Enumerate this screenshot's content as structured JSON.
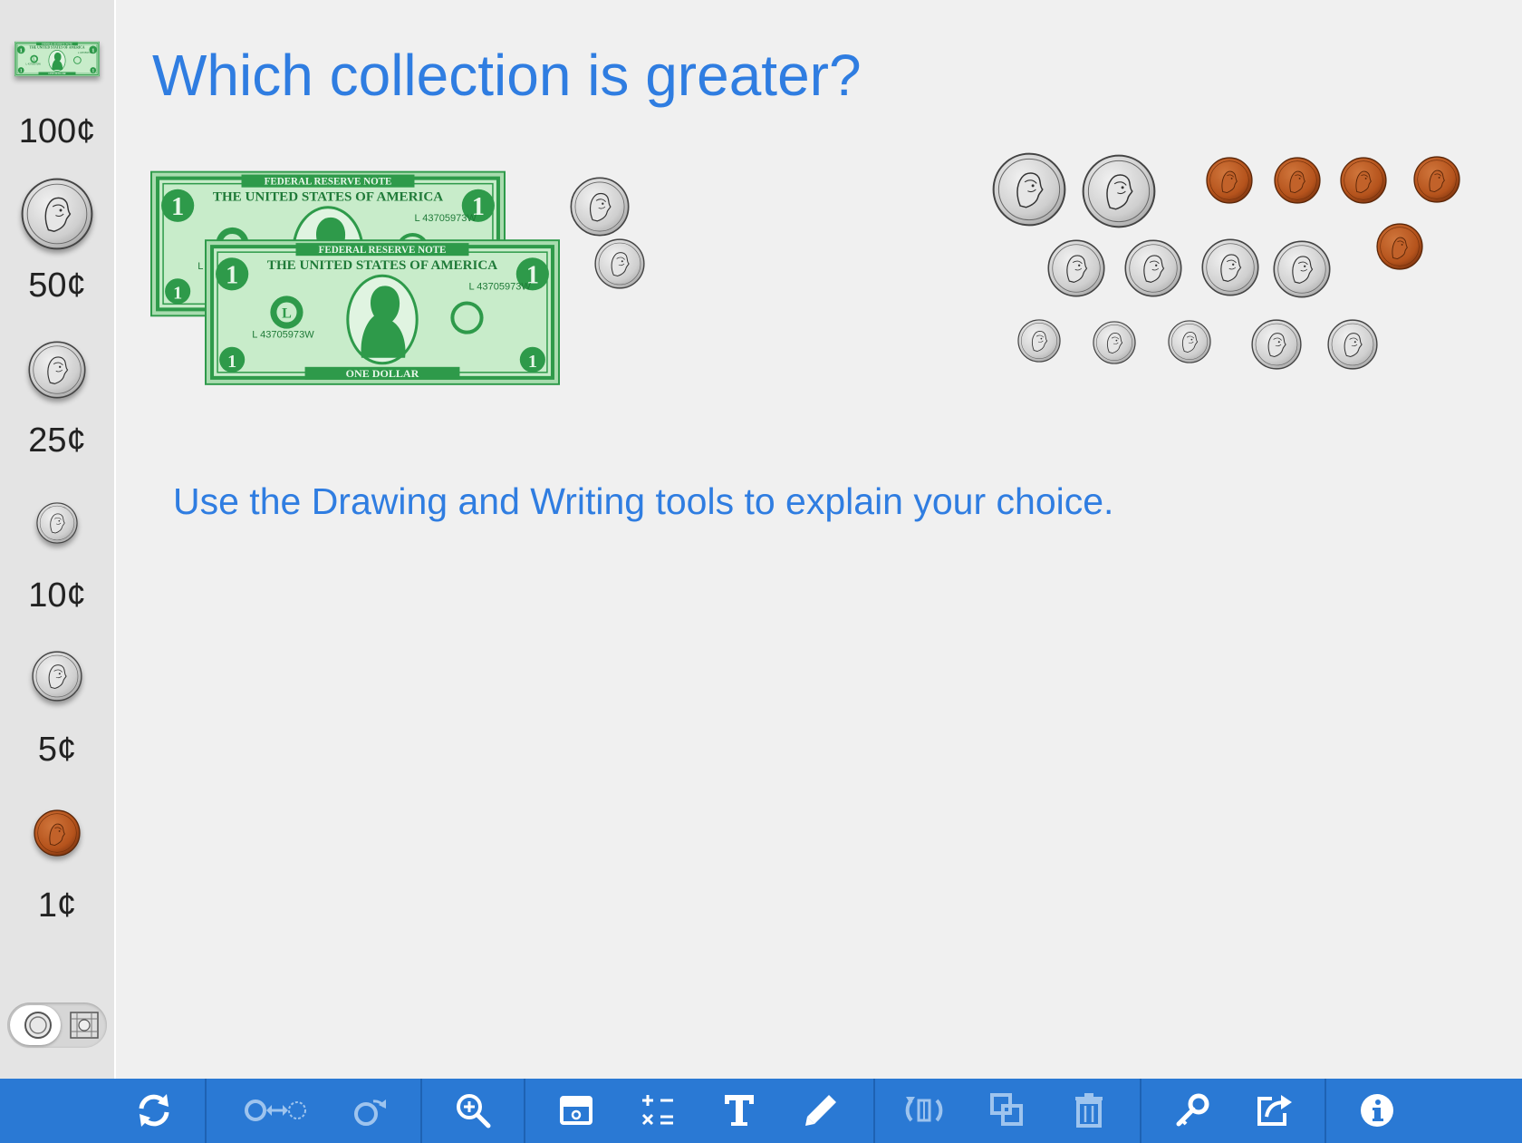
{
  "question": "Which collection is greater?",
  "instruction": "Use the Drawing and Writing tools to explain your choice.",
  "sidebar": {
    "items": [
      {
        "label": "100¢",
        "icon": "dollar-bill-icon"
      },
      {
        "label": "50¢",
        "icon": "half-dollar-coin-icon"
      },
      {
        "label": "25¢",
        "icon": "quarter-coin-icon"
      },
      {
        "label": "10¢",
        "icon": "dime-coin-icon"
      },
      {
        "label": "5¢",
        "icon": "nickel-coin-icon"
      },
      {
        "label": "1¢",
        "icon": "penny-coin-icon"
      }
    ],
    "view_toggle": [
      "coin-face-icon",
      "coin-grid-icon"
    ]
  },
  "bill": {
    "header": "FEDERAL RESERVE NOTE",
    "country": "THE UNITED STATES OF AMERICA",
    "serial": "L 43705973W",
    "denomination": "ONE DOLLAR",
    "number": "1"
  },
  "collection_left": {
    "dollar_bills": 2,
    "quarters": 1,
    "nickels": 1
  },
  "collection_right": {
    "half_dollars": 2,
    "quarters": 4,
    "dimes": 3,
    "nickels": 2,
    "pennies": 5
  },
  "toolbar": {
    "buttons": [
      "reset-icon",
      "swap-coins-icon",
      "flip-coin-icon",
      "zoom-in-icon",
      "hide-show-icon",
      "calculator-icon",
      "text-tool-icon",
      "pencil-icon",
      "rotate-icon",
      "duplicate-icon",
      "trash-icon",
      "key-icon",
      "share-icon",
      "info-icon"
    ]
  },
  "colors": {
    "accent": "#2a79d4",
    "title": "#2f7de1",
    "bill_green": "#2e9a4a",
    "penny": "#b5531c",
    "silver": "#c9c9c9"
  }
}
